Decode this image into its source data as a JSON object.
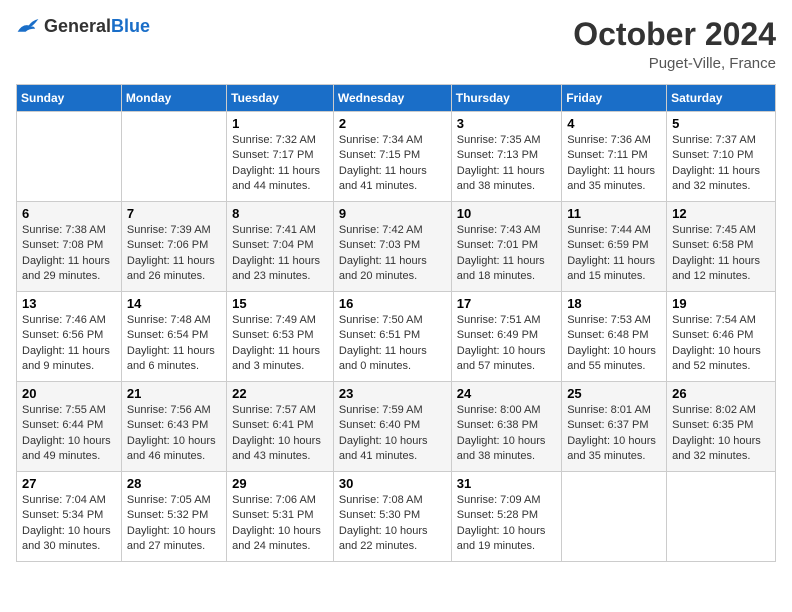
{
  "header": {
    "logo_general": "General",
    "logo_blue": "Blue",
    "month_title": "October 2024",
    "location": "Puget-Ville, France"
  },
  "columns": [
    "Sunday",
    "Monday",
    "Tuesday",
    "Wednesday",
    "Thursday",
    "Friday",
    "Saturday"
  ],
  "rows": [
    [
      {
        "day": "",
        "info": ""
      },
      {
        "day": "",
        "info": ""
      },
      {
        "day": "1",
        "info": "Sunrise: 7:32 AM\nSunset: 7:17 PM\nDaylight: 11 hours and 44 minutes."
      },
      {
        "day": "2",
        "info": "Sunrise: 7:34 AM\nSunset: 7:15 PM\nDaylight: 11 hours and 41 minutes."
      },
      {
        "day": "3",
        "info": "Sunrise: 7:35 AM\nSunset: 7:13 PM\nDaylight: 11 hours and 38 minutes."
      },
      {
        "day": "4",
        "info": "Sunrise: 7:36 AM\nSunset: 7:11 PM\nDaylight: 11 hours and 35 minutes."
      },
      {
        "day": "5",
        "info": "Sunrise: 7:37 AM\nSunset: 7:10 PM\nDaylight: 11 hours and 32 minutes."
      }
    ],
    [
      {
        "day": "6",
        "info": "Sunrise: 7:38 AM\nSunset: 7:08 PM\nDaylight: 11 hours and 29 minutes."
      },
      {
        "day": "7",
        "info": "Sunrise: 7:39 AM\nSunset: 7:06 PM\nDaylight: 11 hours and 26 minutes."
      },
      {
        "day": "8",
        "info": "Sunrise: 7:41 AM\nSunset: 7:04 PM\nDaylight: 11 hours and 23 minutes."
      },
      {
        "day": "9",
        "info": "Sunrise: 7:42 AM\nSunset: 7:03 PM\nDaylight: 11 hours and 20 minutes."
      },
      {
        "day": "10",
        "info": "Sunrise: 7:43 AM\nSunset: 7:01 PM\nDaylight: 11 hours and 18 minutes."
      },
      {
        "day": "11",
        "info": "Sunrise: 7:44 AM\nSunset: 6:59 PM\nDaylight: 11 hours and 15 minutes."
      },
      {
        "day": "12",
        "info": "Sunrise: 7:45 AM\nSunset: 6:58 PM\nDaylight: 11 hours and 12 minutes."
      }
    ],
    [
      {
        "day": "13",
        "info": "Sunrise: 7:46 AM\nSunset: 6:56 PM\nDaylight: 11 hours and 9 minutes."
      },
      {
        "day": "14",
        "info": "Sunrise: 7:48 AM\nSunset: 6:54 PM\nDaylight: 11 hours and 6 minutes."
      },
      {
        "day": "15",
        "info": "Sunrise: 7:49 AM\nSunset: 6:53 PM\nDaylight: 11 hours and 3 minutes."
      },
      {
        "day": "16",
        "info": "Sunrise: 7:50 AM\nSunset: 6:51 PM\nDaylight: 11 hours and 0 minutes."
      },
      {
        "day": "17",
        "info": "Sunrise: 7:51 AM\nSunset: 6:49 PM\nDaylight: 10 hours and 57 minutes."
      },
      {
        "day": "18",
        "info": "Sunrise: 7:53 AM\nSunset: 6:48 PM\nDaylight: 10 hours and 55 minutes."
      },
      {
        "day": "19",
        "info": "Sunrise: 7:54 AM\nSunset: 6:46 PM\nDaylight: 10 hours and 52 minutes."
      }
    ],
    [
      {
        "day": "20",
        "info": "Sunrise: 7:55 AM\nSunset: 6:44 PM\nDaylight: 10 hours and 49 minutes."
      },
      {
        "day": "21",
        "info": "Sunrise: 7:56 AM\nSunset: 6:43 PM\nDaylight: 10 hours and 46 minutes."
      },
      {
        "day": "22",
        "info": "Sunrise: 7:57 AM\nSunset: 6:41 PM\nDaylight: 10 hours and 43 minutes."
      },
      {
        "day": "23",
        "info": "Sunrise: 7:59 AM\nSunset: 6:40 PM\nDaylight: 10 hours and 41 minutes."
      },
      {
        "day": "24",
        "info": "Sunrise: 8:00 AM\nSunset: 6:38 PM\nDaylight: 10 hours and 38 minutes."
      },
      {
        "day": "25",
        "info": "Sunrise: 8:01 AM\nSunset: 6:37 PM\nDaylight: 10 hours and 35 minutes."
      },
      {
        "day": "26",
        "info": "Sunrise: 8:02 AM\nSunset: 6:35 PM\nDaylight: 10 hours and 32 minutes."
      }
    ],
    [
      {
        "day": "27",
        "info": "Sunrise: 7:04 AM\nSunset: 5:34 PM\nDaylight: 10 hours and 30 minutes."
      },
      {
        "day": "28",
        "info": "Sunrise: 7:05 AM\nSunset: 5:32 PM\nDaylight: 10 hours and 27 minutes."
      },
      {
        "day": "29",
        "info": "Sunrise: 7:06 AM\nSunset: 5:31 PM\nDaylight: 10 hours and 24 minutes."
      },
      {
        "day": "30",
        "info": "Sunrise: 7:08 AM\nSunset: 5:30 PM\nDaylight: 10 hours and 22 minutes."
      },
      {
        "day": "31",
        "info": "Sunrise: 7:09 AM\nSunset: 5:28 PM\nDaylight: 10 hours and 19 minutes."
      },
      {
        "day": "",
        "info": ""
      },
      {
        "day": "",
        "info": ""
      }
    ]
  ]
}
